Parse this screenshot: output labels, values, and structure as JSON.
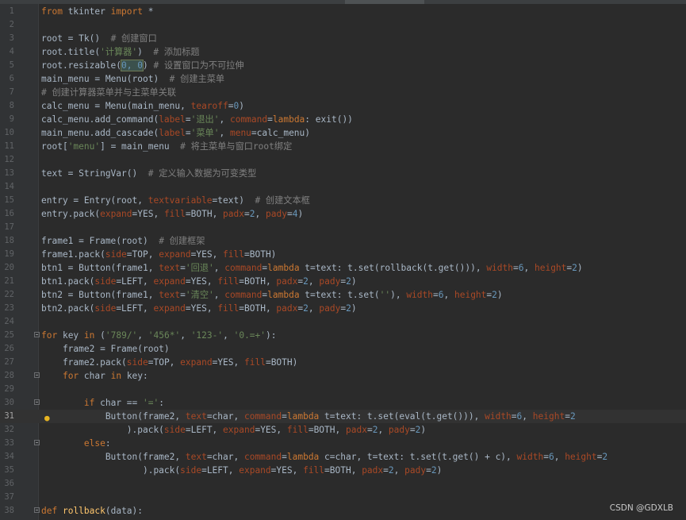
{
  "colors": {
    "background": "#2b2b2b",
    "gutter": "#313335",
    "keyword": "#cc7832",
    "string": "#6a8759",
    "number": "#6897bb",
    "comment": "#808080",
    "param": "#aa4926",
    "default": "#a9b7c6",
    "function_def": "#ffc66d"
  },
  "editor": {
    "language": "python",
    "current_line": 31,
    "lines": [
      {
        "n": "1",
        "tokens": [
          [
            "k",
            "from"
          ],
          [
            "t",
            " tkinter "
          ],
          [
            "k",
            "import"
          ],
          [
            "t",
            " *"
          ]
        ]
      },
      {
        "n": "2",
        "tokens": []
      },
      {
        "n": "3",
        "tokens": [
          [
            "t",
            "root = Tk()  "
          ],
          [
            "c",
            "# 创建窗口"
          ]
        ]
      },
      {
        "n": "4",
        "tokens": [
          [
            "t",
            "root.title("
          ],
          [
            "s",
            "'计算器'"
          ],
          [
            "t",
            ")  "
          ],
          [
            "c",
            "# 添加标题"
          ]
        ]
      },
      {
        "n": "5",
        "tokens": [
          [
            "t",
            "root.resizable("
          ],
          [
            "hl",
            "0, 0"
          ],
          [
            "t",
            ") "
          ],
          [
            "c",
            "# 设置窗口为不可拉伸"
          ]
        ]
      },
      {
        "n": "6",
        "tokens": [
          [
            "t",
            "main_menu = Menu(root)  "
          ],
          [
            "c",
            "# 创建主菜单"
          ]
        ]
      },
      {
        "n": "7",
        "tokens": [
          [
            "c",
            "# 创建计算器菜单并与主菜单关联"
          ]
        ]
      },
      {
        "n": "8",
        "tokens": [
          [
            "t",
            "calc_menu = Menu(main_menu, "
          ],
          [
            "p",
            "tearoff"
          ],
          [
            "t",
            "="
          ],
          [
            "num",
            "0"
          ],
          [
            "t",
            ")"
          ]
        ]
      },
      {
        "n": "9",
        "tokens": [
          [
            "t",
            "calc_menu.add_command("
          ],
          [
            "p",
            "label"
          ],
          [
            "t",
            "="
          ],
          [
            "s",
            "'退出'"
          ],
          [
            "t",
            ", "
          ],
          [
            "p",
            "command"
          ],
          [
            "t",
            "="
          ],
          [
            "k",
            "lambda"
          ],
          [
            "t",
            ": exit())"
          ]
        ]
      },
      {
        "n": "10",
        "tokens": [
          [
            "t",
            "main_menu.add_cascade("
          ],
          [
            "p",
            "label"
          ],
          [
            "t",
            "="
          ],
          [
            "s",
            "'菜单'"
          ],
          [
            "t",
            ", "
          ],
          [
            "p",
            "menu"
          ],
          [
            "t",
            "=calc_menu)"
          ]
        ]
      },
      {
        "n": "11",
        "tokens": [
          [
            "t",
            "root["
          ],
          [
            "s",
            "'menu'"
          ],
          [
            "t",
            "] = main_menu  "
          ],
          [
            "c",
            "# 将主菜单与窗口root绑定"
          ]
        ]
      },
      {
        "n": "12",
        "tokens": []
      },
      {
        "n": "13",
        "tokens": [
          [
            "t",
            "text = StringVar()  "
          ],
          [
            "c",
            "# 定义输入数据为可变类型"
          ]
        ]
      },
      {
        "n": "14",
        "tokens": []
      },
      {
        "n": "15",
        "tokens": [
          [
            "t",
            "entry = Entry(root, "
          ],
          [
            "p",
            "textvariable"
          ],
          [
            "t",
            "=text)  "
          ],
          [
            "c",
            "# 创建文本框"
          ]
        ]
      },
      {
        "n": "16",
        "tokens": [
          [
            "t",
            "entry.pack("
          ],
          [
            "p",
            "expand"
          ],
          [
            "t",
            "=YES, "
          ],
          [
            "p",
            "fill"
          ],
          [
            "t",
            "=BOTH, "
          ],
          [
            "p",
            "padx"
          ],
          [
            "t",
            "="
          ],
          [
            "num",
            "2"
          ],
          [
            "t",
            ", "
          ],
          [
            "p",
            "pady"
          ],
          [
            "t",
            "="
          ],
          [
            "num",
            "4"
          ],
          [
            "t",
            ")"
          ]
        ]
      },
      {
        "n": "17",
        "tokens": []
      },
      {
        "n": "18",
        "tokens": [
          [
            "t",
            "frame1 = Frame(root)  "
          ],
          [
            "c",
            "# 创建框架"
          ]
        ]
      },
      {
        "n": "19",
        "tokens": [
          [
            "t",
            "frame1.pack("
          ],
          [
            "p",
            "side"
          ],
          [
            "t",
            "=TOP, "
          ],
          [
            "p",
            "expand"
          ],
          [
            "t",
            "=YES, "
          ],
          [
            "p",
            "fill"
          ],
          [
            "t",
            "=BOTH)"
          ]
        ]
      },
      {
        "n": "20",
        "tokens": [
          [
            "t",
            "btn1 = Button(frame1, "
          ],
          [
            "p",
            "text"
          ],
          [
            "t",
            "="
          ],
          [
            "s",
            "'回退'"
          ],
          [
            "t",
            ", "
          ],
          [
            "p",
            "command"
          ],
          [
            "t",
            "="
          ],
          [
            "k",
            "lambda"
          ],
          [
            "t",
            " t=text: t.set(rollback(t.get())), "
          ],
          [
            "p",
            "width"
          ],
          [
            "t",
            "="
          ],
          [
            "num",
            "6"
          ],
          [
            "t",
            ", "
          ],
          [
            "p",
            "height"
          ],
          [
            "t",
            "="
          ],
          [
            "num",
            "2"
          ],
          [
            "t",
            ")"
          ]
        ]
      },
      {
        "n": "21",
        "tokens": [
          [
            "t",
            "btn1.pack("
          ],
          [
            "p",
            "side"
          ],
          [
            "t",
            "=LEFT, "
          ],
          [
            "p",
            "expand"
          ],
          [
            "t",
            "=YES, "
          ],
          [
            "p",
            "fill"
          ],
          [
            "t",
            "=BOTH, "
          ],
          [
            "p",
            "padx"
          ],
          [
            "t",
            "="
          ],
          [
            "num",
            "2"
          ],
          [
            "t",
            ", "
          ],
          [
            "p",
            "pady"
          ],
          [
            "t",
            "="
          ],
          [
            "num",
            "2"
          ],
          [
            "t",
            ")"
          ]
        ]
      },
      {
        "n": "22",
        "tokens": [
          [
            "t",
            "btn2 = Button(frame1, "
          ],
          [
            "p",
            "text"
          ],
          [
            "t",
            "="
          ],
          [
            "s",
            "'清空'"
          ],
          [
            "t",
            ", "
          ],
          [
            "p",
            "command"
          ],
          [
            "t",
            "="
          ],
          [
            "k",
            "lambda"
          ],
          [
            "t",
            " t=text: t.set("
          ],
          [
            "s",
            "''"
          ],
          [
            "t",
            "), "
          ],
          [
            "p",
            "width"
          ],
          [
            "t",
            "="
          ],
          [
            "num",
            "6"
          ],
          [
            "t",
            ", "
          ],
          [
            "p",
            "height"
          ],
          [
            "t",
            "="
          ],
          [
            "num",
            "2"
          ],
          [
            "t",
            ")"
          ]
        ]
      },
      {
        "n": "23",
        "tokens": [
          [
            "t",
            "btn2.pack("
          ],
          [
            "p",
            "side"
          ],
          [
            "t",
            "=LEFT, "
          ],
          [
            "p",
            "expand"
          ],
          [
            "t",
            "=YES, "
          ],
          [
            "p",
            "fill"
          ],
          [
            "t",
            "=BOTH, "
          ],
          [
            "p",
            "padx"
          ],
          [
            "t",
            "="
          ],
          [
            "num",
            "2"
          ],
          [
            "t",
            ", "
          ],
          [
            "p",
            "pady"
          ],
          [
            "t",
            "="
          ],
          [
            "num",
            "2"
          ],
          [
            "t",
            ")"
          ]
        ]
      },
      {
        "n": "24",
        "tokens": []
      },
      {
        "n": "25",
        "fold": true,
        "tokens": [
          [
            "k",
            "for"
          ],
          [
            "t",
            " key "
          ],
          [
            "k",
            "in"
          ],
          [
            "t",
            " ("
          ],
          [
            "s",
            "'789/'"
          ],
          [
            "t",
            ", "
          ],
          [
            "s",
            "'456*'"
          ],
          [
            "t",
            ", "
          ],
          [
            "s",
            "'123-'"
          ],
          [
            "t",
            ", "
          ],
          [
            "s",
            "'0.=+'"
          ],
          [
            "t",
            "):"
          ]
        ]
      },
      {
        "n": "26",
        "tokens": [
          [
            "t",
            "    frame2 = Frame(root)"
          ]
        ]
      },
      {
        "n": "27",
        "tokens": [
          [
            "t",
            "    frame2.pack("
          ],
          [
            "p",
            "side"
          ],
          [
            "t",
            "=TOP, "
          ],
          [
            "p",
            "expand"
          ],
          [
            "t",
            "=YES, "
          ],
          [
            "p",
            "fill"
          ],
          [
            "t",
            "=BOTH)"
          ]
        ]
      },
      {
        "n": "28",
        "fold": true,
        "tokens": [
          [
            "t",
            "    "
          ],
          [
            "k",
            "for"
          ],
          [
            "t",
            " char "
          ],
          [
            "k",
            "in"
          ],
          [
            "t",
            " key:"
          ]
        ]
      },
      {
        "n": "29",
        "tokens": []
      },
      {
        "n": "30",
        "fold": true,
        "tokens": [
          [
            "t",
            "        "
          ],
          [
            "k",
            "if"
          ],
          [
            "t",
            " char == "
          ],
          [
            "s",
            "'='"
          ],
          [
            "t",
            ":"
          ]
        ]
      },
      {
        "n": "31",
        "bulb": true,
        "tokens": [
          [
            "t",
            "            Button(frame2, "
          ],
          [
            "p",
            "text"
          ],
          [
            "t",
            "=char, "
          ],
          [
            "p",
            "command"
          ],
          [
            "t",
            "="
          ],
          [
            "k",
            "lambda"
          ],
          [
            "t",
            " t=text: t.set(eval(t.get())), "
          ],
          [
            "p",
            "width"
          ],
          [
            "t",
            "="
          ],
          [
            "num",
            "6"
          ],
          [
            "t",
            ", "
          ],
          [
            "p",
            "height"
          ],
          [
            "t",
            "="
          ],
          [
            "num",
            "2"
          ]
        ]
      },
      {
        "n": "32",
        "tokens": [
          [
            "t",
            "                ).pack("
          ],
          [
            "p",
            "side"
          ],
          [
            "t",
            "=LEFT, "
          ],
          [
            "p",
            "expand"
          ],
          [
            "t",
            "=YES, "
          ],
          [
            "p",
            "fill"
          ],
          [
            "t",
            "=BOTH, "
          ],
          [
            "p",
            "padx"
          ],
          [
            "t",
            "="
          ],
          [
            "num",
            "2"
          ],
          [
            "t",
            ", "
          ],
          [
            "p",
            "pady"
          ],
          [
            "t",
            "="
          ],
          [
            "num",
            "2"
          ],
          [
            "t",
            ")"
          ]
        ]
      },
      {
        "n": "33",
        "fold": true,
        "tokens": [
          [
            "t",
            "        "
          ],
          [
            "k",
            "else"
          ],
          [
            "t",
            ":"
          ]
        ]
      },
      {
        "n": "34",
        "tokens": [
          [
            "t",
            "            Button(frame2, "
          ],
          [
            "p",
            "text"
          ],
          [
            "t",
            "=char, "
          ],
          [
            "p",
            "command"
          ],
          [
            "t",
            "="
          ],
          [
            "k",
            "lambda"
          ],
          [
            "t",
            " c=char, t=text: t.set(t.get() + c), "
          ],
          [
            "p",
            "width"
          ],
          [
            "t",
            "="
          ],
          [
            "num",
            "6"
          ],
          [
            "t",
            ", "
          ],
          [
            "p",
            "height"
          ],
          [
            "t",
            "="
          ],
          [
            "num",
            "2"
          ]
        ]
      },
      {
        "n": "35",
        "tokens": [
          [
            "t",
            "                   ).pack("
          ],
          [
            "p",
            "side"
          ],
          [
            "t",
            "=LEFT, "
          ],
          [
            "p",
            "expand"
          ],
          [
            "t",
            "=YES, "
          ],
          [
            "p",
            "fill"
          ],
          [
            "t",
            "=BOTH, "
          ],
          [
            "p",
            "padx"
          ],
          [
            "t",
            "="
          ],
          [
            "num",
            "2"
          ],
          [
            "t",
            ", "
          ],
          [
            "p",
            "pady"
          ],
          [
            "t",
            "="
          ],
          [
            "num",
            "2"
          ],
          [
            "t",
            ")"
          ]
        ]
      },
      {
        "n": "36",
        "tokens": []
      },
      {
        "n": "37",
        "tokens": []
      },
      {
        "n": "38",
        "fold": true,
        "tokens": [
          [
            "k",
            "def"
          ],
          [
            "t",
            " "
          ],
          [
            "fn",
            "rollback"
          ],
          [
            "t",
            "(data):"
          ]
        ]
      }
    ]
  },
  "watermark": "CSDN @GDXLB"
}
